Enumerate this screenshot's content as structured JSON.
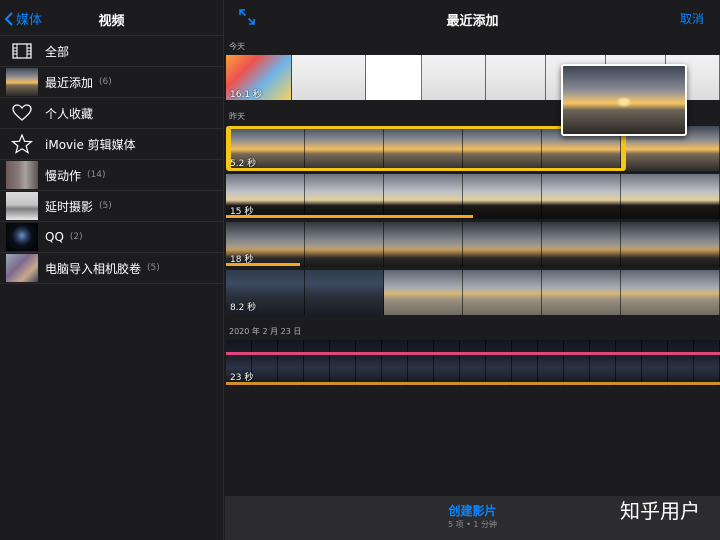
{
  "sidebar": {
    "back_label": "媒体",
    "title": "视频",
    "items": [
      {
        "label": "全部",
        "count": "",
        "icon": "film-icon"
      },
      {
        "label": "最近添加",
        "count": "(6)",
        "icon": "thumbnail"
      },
      {
        "label": "个人收藏",
        "count": "",
        "icon": "heart-icon"
      },
      {
        "label": "iMovie 剪辑媒体",
        "count": "",
        "icon": "star-icon"
      },
      {
        "label": "慢动作",
        "count": "(14)",
        "icon": "thumbnail"
      },
      {
        "label": "延时摄影",
        "count": "(5)",
        "icon": "thumbnail"
      },
      {
        "label": "QQ",
        "count": "(2)",
        "icon": "thumbnail"
      },
      {
        "label": "电脑导入相机胶卷",
        "count": "(5)",
        "icon": "thumbnail"
      }
    ]
  },
  "main": {
    "title": "最近添加",
    "cancel_label": "取消",
    "sections": {
      "today": "今天",
      "yesterday": "昨天",
      "date": "2020 年 2 月 23 日"
    },
    "clips": [
      {
        "duration": "16.1 秒",
        "progress": 0.0
      },
      {
        "duration": "5.2 秒",
        "progress": 1.0
      },
      {
        "duration": "15 秒",
        "progress": 0.5
      },
      {
        "duration": "18 秒",
        "progress": 0.15
      },
      {
        "duration": "8.2 秒",
        "progress": 0.0
      },
      {
        "duration": "23 秒",
        "progress": 0.0
      }
    ]
  },
  "footer": {
    "create_label": "创建影片",
    "summary": "5 项 • 1 分钟"
  },
  "watermark": "知乎用户",
  "colors": {
    "accent": "#0a84ff",
    "selection": "#f5c518",
    "progress": "#f5a623"
  }
}
